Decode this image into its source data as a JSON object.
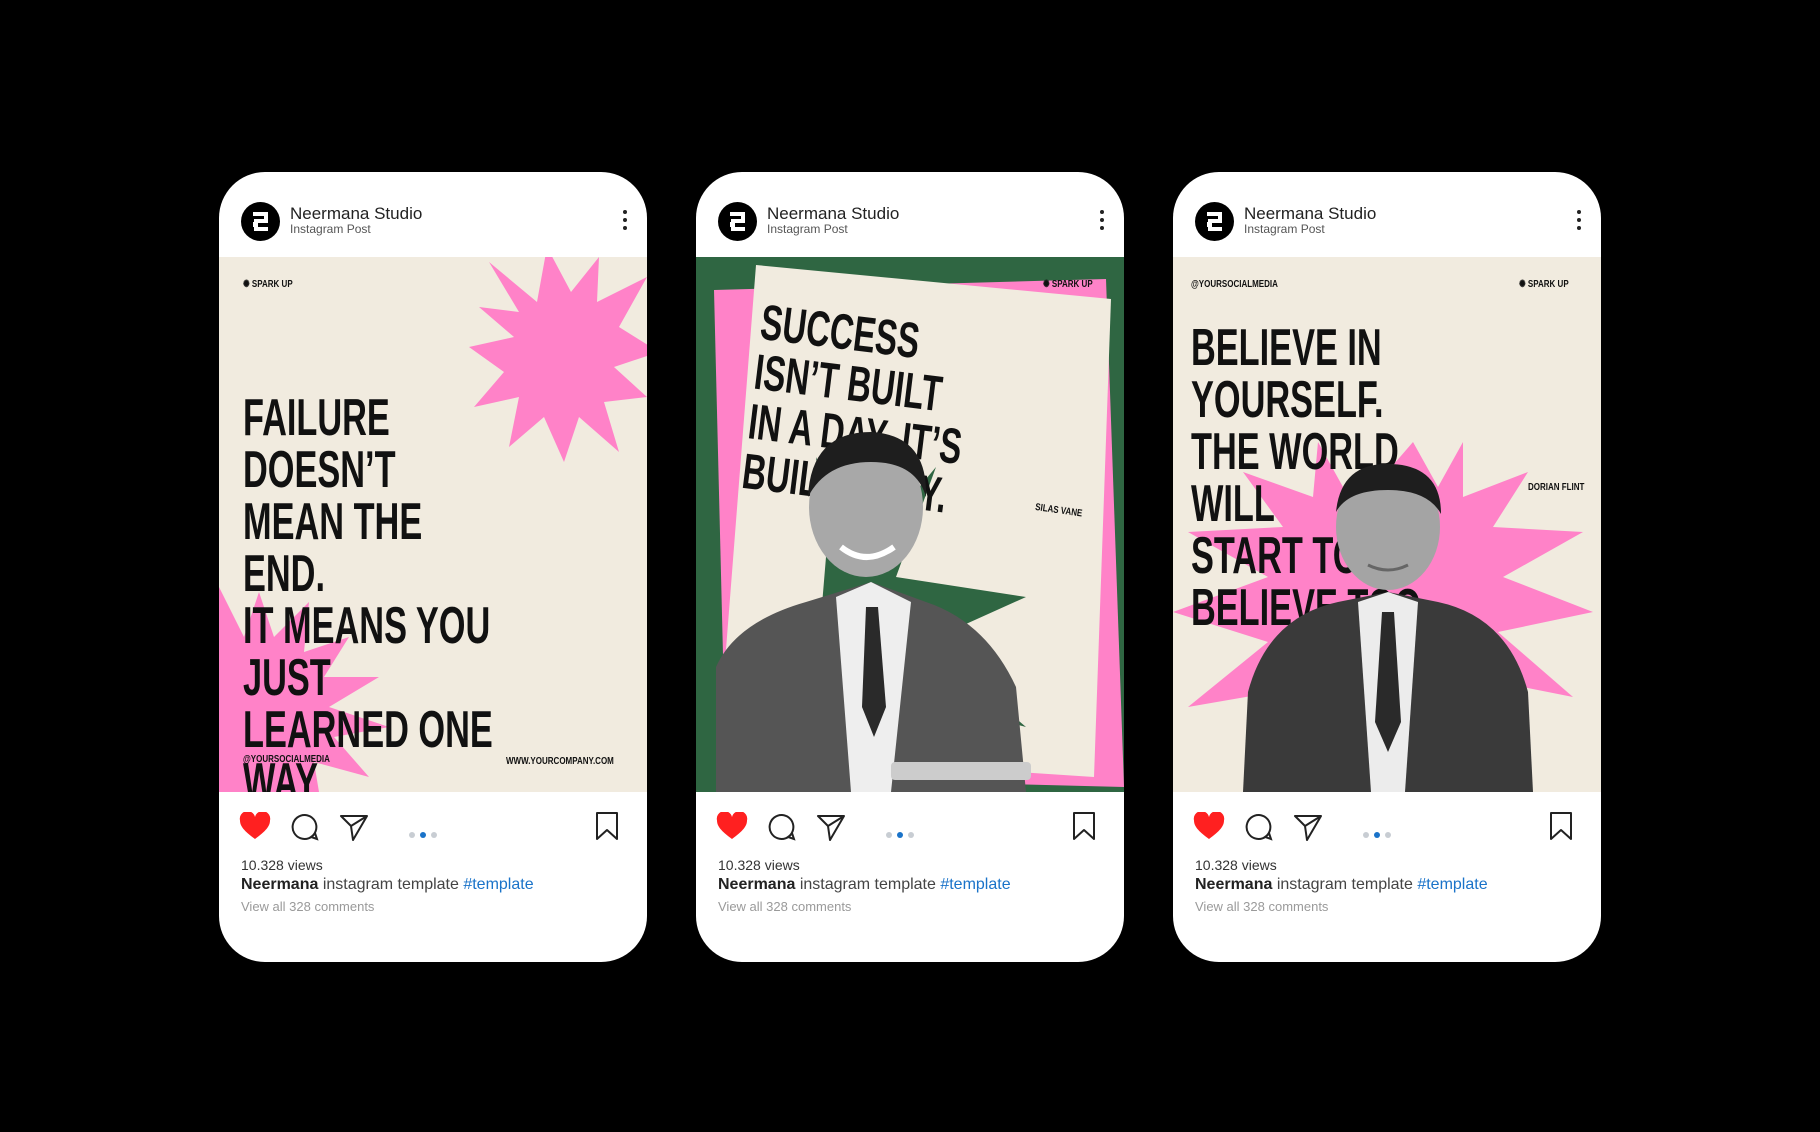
{
  "colors": {
    "pink": "#ff82c8",
    "cream": "#f1ebdf",
    "green": "#2f6642",
    "heart": "#ff2020",
    "link": "#1a73c9"
  },
  "posts": [
    {
      "account": "Neermana Studio",
      "subtitle": "Instagram Post",
      "badge": "✺ SPARK UP",
      "quote": "FAILURE DOESN’T\nMEAN THE END.\nIT MEANS YOU JUST\nLEARNED ONE WAY\nTHAT DOESN’T WORK.",
      "handle": "@YOURSOCIALMEDIA",
      "website": "WWW.YOURCOMPANY.COM",
      "views": "10.328 views",
      "caption_user": "Neermana",
      "caption_text": " instagram template ",
      "caption_tag": "#template",
      "comments": "View all 328 comments"
    },
    {
      "account": "Neermana Studio",
      "subtitle": "Instagram Post",
      "badge": "✺ SPARK UP",
      "quote": "SUCCESS ISN’T BUILT\nIN A DAY. IT’S\nBUILT DAILY.",
      "author": "SILAS VANE",
      "views": "10.328 views",
      "caption_user": "Neermana",
      "caption_text": " instagram template ",
      "caption_tag": "#template",
      "comments": "View all 328 comments"
    },
    {
      "account": "Neermana Studio",
      "subtitle": "Instagram Post",
      "handle": "@YOURSOCIALMEDIA",
      "badge": "✺ SPARK UP",
      "quote": "BELIEVE IN YOURSELF.\nTHE WORLD WILL\nSTART TO BELIEVE TOO.",
      "author": "DORIAN FLINT",
      "views": "10.328 views",
      "caption_user": "Neermana",
      "caption_text": " instagram template ",
      "caption_tag": "#template",
      "comments": "View all 328 comments"
    }
  ]
}
